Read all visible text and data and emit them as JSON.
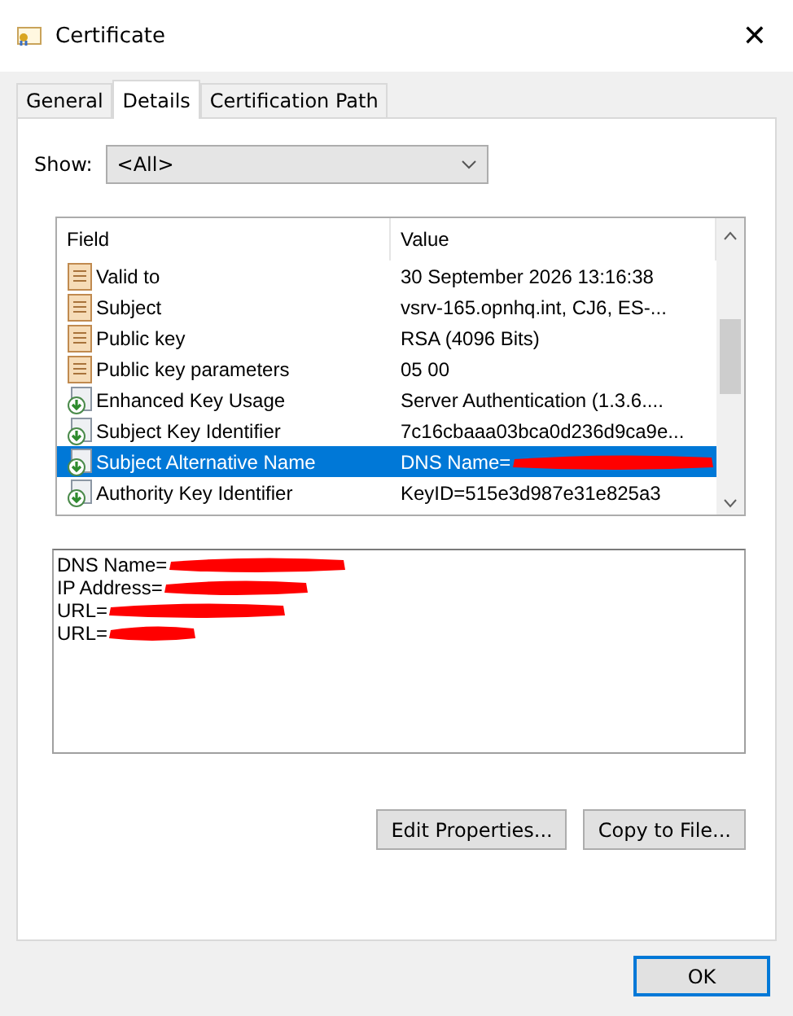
{
  "window": {
    "title": "Certificate",
    "close": "✕"
  },
  "tabs": [
    {
      "label": "General",
      "selected": false
    },
    {
      "label": "Details",
      "selected": true
    },
    {
      "label": "Certification Path",
      "selected": false
    }
  ],
  "show": {
    "label": "Show:",
    "value": "<All>"
  },
  "list": {
    "columns": [
      "Field",
      "Value"
    ],
    "rows": [
      {
        "kind": "property",
        "field": "Valid to",
        "value": "30 September 2026 13:16:38",
        "selected": false,
        "redacted": false
      },
      {
        "kind": "property",
        "field": "Subject",
        "value": "vsrv-165.opnhq.int, CJ6, ES-...",
        "selected": false,
        "redacted": false
      },
      {
        "kind": "property",
        "field": "Public key",
        "value": "RSA (4096 Bits)",
        "selected": false,
        "redacted": false
      },
      {
        "kind": "property",
        "field": "Public key parameters",
        "value": "05 00",
        "selected": false,
        "redacted": false
      },
      {
        "kind": "extension",
        "field": "Enhanced Key Usage",
        "value": "Server Authentication (1.3.6....",
        "selected": false,
        "redacted": false
      },
      {
        "kind": "extension",
        "field": "Subject Key Identifier",
        "value": "7c16cbaaa03bca0d236d9ca9e...",
        "selected": false,
        "redacted": false
      },
      {
        "kind": "extension",
        "field": "Subject Alternative Name",
        "value": "DNS Name=",
        "selected": true,
        "redacted": true
      },
      {
        "kind": "extension",
        "field": "Authority Key Identifier",
        "value": "KeyID=515e3d987e31e825a3",
        "selected": false,
        "redacted": false
      }
    ]
  },
  "detail_lines": [
    {
      "text": "DNS Name=",
      "redacted": true
    },
    {
      "text": "IP Address=",
      "redacted": true
    },
    {
      "text": "URL=",
      "redacted": true
    },
    {
      "text": "URL=",
      "redacted": true
    }
  ],
  "buttons": [
    "Edit Properties...",
    "Copy to File..."
  ],
  "ok_button": "OK"
}
